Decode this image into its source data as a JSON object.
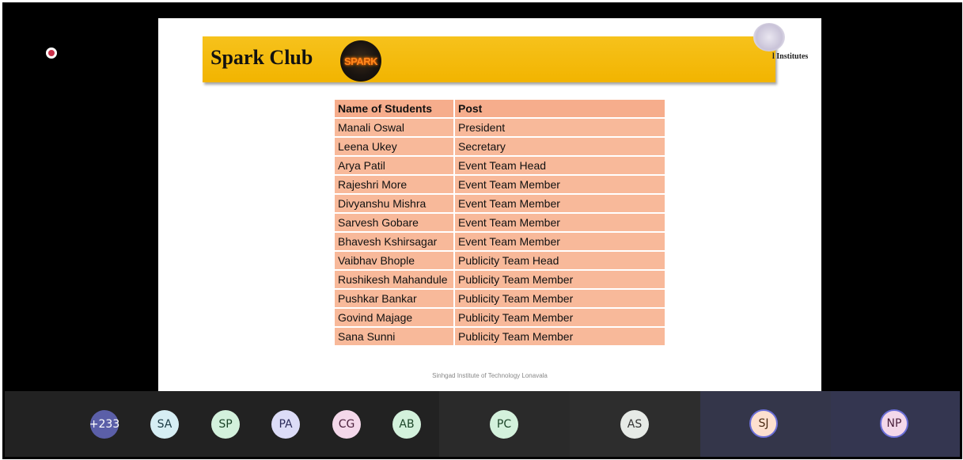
{
  "slide": {
    "title": "Spark Club",
    "club_logo_text": "SPARK",
    "institute_text": "l Institutes",
    "footer": "Sinhgad Institute of Technology Lonavala"
  },
  "table": {
    "headers": [
      "Name of Students",
      "Post"
    ],
    "rows": [
      {
        "name": "Manali Oswal",
        "post": "President"
      },
      {
        "name": "Leena Ukey",
        "post": "Secretary"
      },
      {
        "name": "Arya Patil",
        "post": "Event Team Head"
      },
      {
        "name": "Rajeshri More",
        "post": "Event Team Member"
      },
      {
        "name": "Divyanshu Mishra",
        "post": "Event Team Member"
      },
      {
        "name": "Sarvesh Gobare",
        "post": "Event Team Member"
      },
      {
        "name": "Bhavesh Kshirsagar",
        "post": "Event Team Member"
      },
      {
        "name": "Vaibhav Bhople",
        "post": "Publicity Team Head"
      },
      {
        "name": "Rushikesh Mahandule",
        "post": "Publicity Team Member"
      },
      {
        "name": "Pushkar Bankar",
        "post": "Publicity Team Member"
      },
      {
        "name": "Govind Majage",
        "post": "Publicity Team Member"
      },
      {
        "name": "Sana Sunni",
        "post": "Publicity Team Member"
      }
    ]
  },
  "participants": [
    {
      "initials": "+233",
      "bg": "#5b5fa8",
      "fg": "#ffffff"
    },
    {
      "initials": "SA",
      "bg": "#d6eef4",
      "fg": "#1b3b45"
    },
    {
      "initials": "SP",
      "bg": "#d3f1dc",
      "fg": "#1b4528"
    },
    {
      "initials": "PA",
      "bg": "#dcdcf7",
      "fg": "#2b2b5a"
    },
    {
      "initials": "CG",
      "bg": "#f4d8ea",
      "fg": "#4a1f3b"
    },
    {
      "initials": "AB",
      "bg": "#d3f1dc",
      "fg": "#1b4528"
    },
    {
      "initials": "PC",
      "bg": "#d3f1dc",
      "fg": "#1b4528"
    },
    {
      "initials": "AS",
      "bg": "#e6eae6",
      "fg": "#333333"
    },
    {
      "initials": "SJ",
      "bg": "#fde0cf",
      "fg": "#4a2a12"
    },
    {
      "initials": "NP",
      "bg": "#f4d8ea",
      "fg": "#4a1f3b"
    }
  ],
  "colors": {
    "accent": "#f2b400",
    "table_cell": "#f8b99a",
    "recording": "#c9314a"
  },
  "icons": [
    "recording-indicator-icon",
    "club-logo-icon",
    "institute-logo-icon"
  ]
}
